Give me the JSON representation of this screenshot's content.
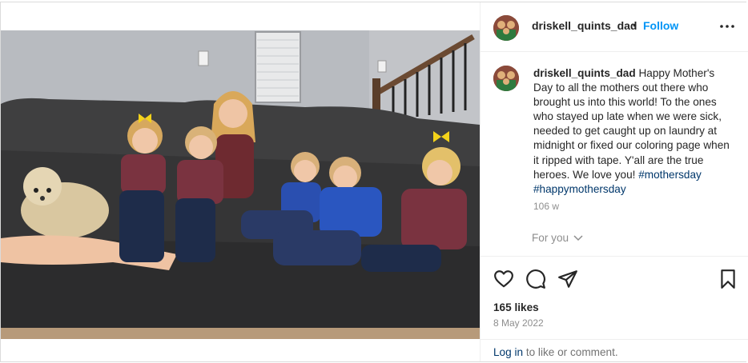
{
  "post": {
    "username": "driskell_quints_dad",
    "separator": "•",
    "follow_label": "Follow",
    "more_icon": "more-horizontal-icon",
    "photo_alt": "Family photo"
  },
  "caption": {
    "username": "driskell_quints_dad",
    "text": "Happy Mother's Day to all the mothers out there who brought us into this world! To the ones who stayed up late when we were sick, needed to get caught up on laundry at midnight or fixed our coloring page when it ripped with tape. Y'all are the true heroes. We love you!",
    "hashtags": [
      "#mothersday",
      "#happymothersday"
    ],
    "time_ago": "106 w"
  },
  "for_you_label": "For you",
  "actions": {
    "icons": [
      "heart-icon",
      "comment-icon",
      "share-icon",
      "bookmark-icon"
    ]
  },
  "likes": "165 likes",
  "date": "8 May 2022",
  "login": {
    "link": "Log in",
    "rest": " to like or comment."
  },
  "colors": {
    "follow": "#0095f6",
    "hashtag": "#00376b",
    "muted": "#8e8e8e",
    "border": "#dbdbdb"
  }
}
